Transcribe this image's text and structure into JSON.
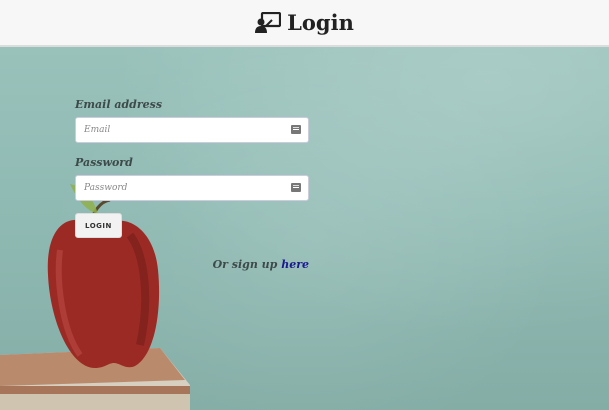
{
  "header": {
    "title": "Login",
    "icon": "presentation-user-icon"
  },
  "form": {
    "email_label": "Email address",
    "email_placeholder": "Email",
    "email_value": "",
    "password_label": "Password",
    "password_placeholder": "Password",
    "password_value": "",
    "login_button": "LOGIN"
  },
  "signup": {
    "prefix": "Or sign up",
    "link_text": "here"
  },
  "colors": {
    "header_bg": "#f7f7f7",
    "chalkboard": "#8fb9b2",
    "link": "#1a1a8f"
  }
}
